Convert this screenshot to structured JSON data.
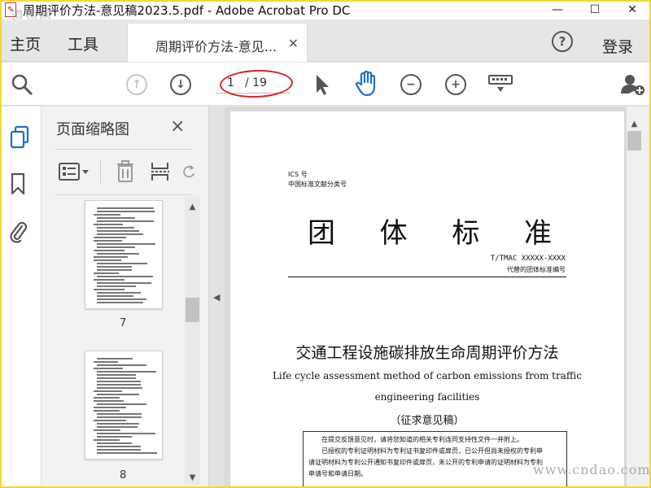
{
  "window": {
    "title": "周期评价方法-意见稿2023.5.pdf - Adobe Acrobat Pro DC",
    "watermark": "道标网",
    "controls": {
      "minimize": "—",
      "maximize": "☐",
      "close": "✕"
    }
  },
  "tabbar": {
    "home": "主页",
    "tools": "工具",
    "doc_tab": "周期评价方法-意见...",
    "close": "×",
    "help": "?",
    "login": "登录"
  },
  "toolbar": {
    "page_current": "1",
    "page_total": "/ 19",
    "icons": [
      "search-icon",
      "page-up-icon",
      "page-down-icon",
      "select-pointer-icon",
      "hand-tool-icon",
      "zoom-out-icon",
      "zoom-in-icon",
      "keyboard-tools-icon",
      "share-user-icon"
    ],
    "highlight_color": "#dd2222"
  },
  "sidebar": {
    "title": "页面缩略图",
    "close": "×",
    "thumbnails": [
      {
        "label": "7"
      },
      {
        "label": "8"
      }
    ]
  },
  "document": {
    "ics": "ICS 号",
    "classification": "中国标准文献分类号",
    "standard_chars": [
      "团",
      "体",
      "标",
      "准"
    ],
    "code": "T/TMAC XXXXX-XXXX",
    "replace_note": "代替的团体标准编号",
    "title_cn": "交通工程设施碳排放生命周期评价方法",
    "title_en_line1": "Life cycle assessment method of carbon emissions from traffic",
    "title_en_line2": "engineering facilities",
    "draft_status": "（征求意见稿）",
    "note_lines": [
      "在提交反馈意见时，请将您知道的相关专利连同支持性文件一并附上。",
      "已授权的专利证明材料为专利证书复印件或扉页，已公开但尚未授权的专利申",
      "请证明材料为专利公开通知书复印件或扉页，未公开的专利申请的证明材料为专利",
      "申请号和申请日期。"
    ]
  },
  "footer_watermark": "www.cndao.com"
}
